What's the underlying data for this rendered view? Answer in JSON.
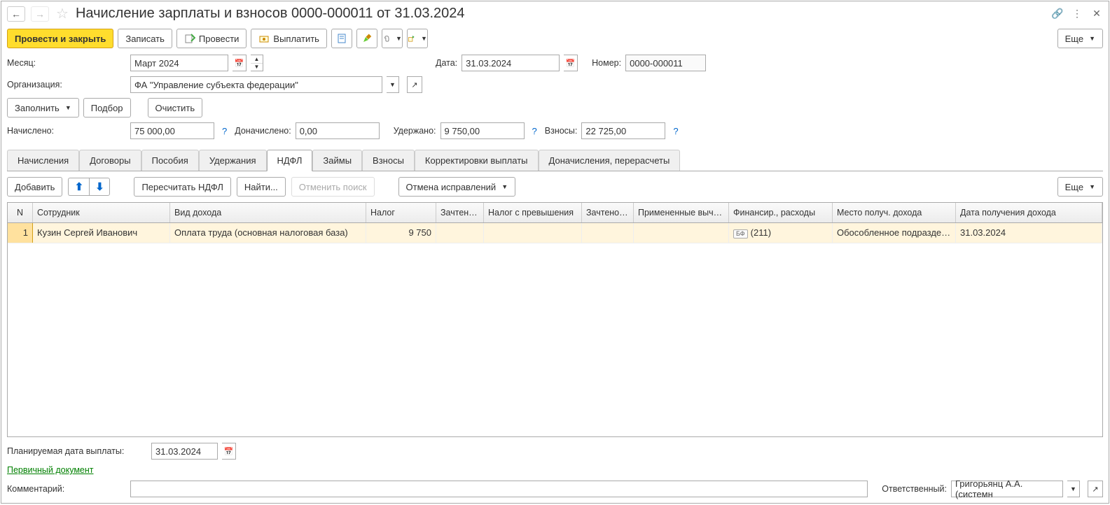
{
  "title": "Начисление зарплаты и взносов 0000-000011 от 31.03.2024",
  "toolbar": {
    "post_close": "Провести и закрыть",
    "write": "Записать",
    "post": "Провести",
    "pay": "Выплатить",
    "more": "Еще"
  },
  "fields": {
    "month_label": "Месяц:",
    "month": "Март 2024",
    "date_label": "Дата:",
    "date": "31.03.2024",
    "number_label": "Номер:",
    "number": "0000-000011",
    "org_label": "Организация:",
    "org": "ФА \"Управление субъекта федерации\"",
    "fill": "Заполнить",
    "pick": "Подбор",
    "clear": "Очистить",
    "accrued_label": "Начислено:",
    "accrued": "75 000,00",
    "addaccrued_label": "Доначислено:",
    "addaccrued": "0,00",
    "withheld_label": "Удержано:",
    "withheld": "9 750,00",
    "contrib_label": "Взносы:",
    "contrib": "22 725,00"
  },
  "tabs": [
    "Начисления",
    "Договоры",
    "Пособия",
    "Удержания",
    "НДФЛ",
    "Займы",
    "Взносы",
    "Корректировки выплаты",
    "Доначисления, перерасчеты"
  ],
  "active_tab": 4,
  "tab_toolbar": {
    "add": "Добавить",
    "recalc": "Пересчитать НДФЛ",
    "find": "Найти...",
    "cancel_search": "Отменить поиск",
    "cancel_fix": "Отмена исправлений",
    "more": "Еще"
  },
  "columns": {
    "n": "N",
    "employee": "Сотрудник",
    "income_type": "Вид дохода",
    "tax": "Налог",
    "credited": "Зачтен…",
    "tax_excess": "Налог с превышения",
    "credited2": "Зачтено…",
    "deductions": "Примененные выч…",
    "financing": "Финансир., расходы",
    "place": "Место получ. дохода",
    "income_date": "Дата получения дохода"
  },
  "row": {
    "n": "1",
    "employee": "Кузин Сергей Иванович",
    "income_type": "Оплата труда (основная налоговая база)",
    "tax": "9 750",
    "credited": "",
    "tax_excess": "",
    "credited2": "",
    "deductions": "",
    "financing_code": "БФ",
    "financing": "(211)",
    "place": "Обособленное подразде…",
    "income_date": "31.03.2024"
  },
  "bottom": {
    "planned_date_label": "Планируемая дата выплаты:",
    "planned_date": "31.03.2024",
    "primary_doc": "Первичный документ",
    "comment_label": "Комментарий:",
    "responsible_label": "Ответственный:",
    "responsible": "Григорьянц А.А. (системн"
  }
}
